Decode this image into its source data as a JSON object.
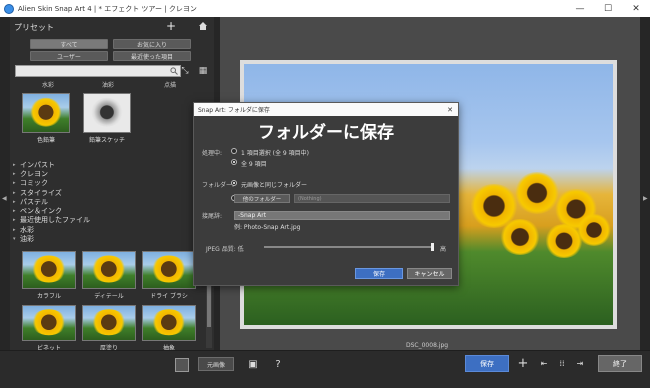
{
  "window": {
    "title": "Alien Skin Snap Art 4 | * エフェクト ツアー | クレヨン",
    "controls": [
      "—",
      "☐",
      "✕"
    ]
  },
  "sidebar": {
    "preset_title": "プリセット",
    "filters": {
      "all": "すべて",
      "favorites": "お気に入り",
      "user": "ユーザー",
      "recent": "最近使った項目"
    },
    "categories": {
      "watercolor": "水彩",
      "pencil": "油彩",
      "pointillism": "点描"
    },
    "top_thumbs": [
      "色鉛筆",
      "鉛筆スケッチ"
    ],
    "tree": [
      {
        "caret": "▸",
        "label": "インパスト"
      },
      {
        "caret": "▸",
        "label": "クレヨン"
      },
      {
        "caret": "▸",
        "label": "コミック"
      },
      {
        "caret": "▸",
        "label": "スタイライズ"
      },
      {
        "caret": "▸",
        "label": "パステル"
      },
      {
        "caret": "▸",
        "label": "ペン＆インク"
      },
      {
        "caret": "▸",
        "label": "最近使用したファイル"
      },
      {
        "caret": "▸",
        "label": "水彩"
      },
      {
        "caret": "▾",
        "label": "油彩"
      }
    ],
    "grid_thumbs": [
      "カラフル",
      "ディテール",
      "ドライ ブラシ",
      "ビネット",
      "厚塗り",
      "抽象"
    ]
  },
  "canvas": {
    "filename": "DSC_0008.jpg"
  },
  "bottombar": {
    "original_label": "元画像",
    "help_icon": "?",
    "save_label": "保存",
    "end_label": "終了"
  },
  "dialog": {
    "title": "Snap Art: フォルダに保存",
    "close": "✕",
    "heading": "フォルダーに保存",
    "process_label": "処理中:",
    "process_selected": "1 項目選択 (全 9 項目中)",
    "process_all": "全 9 項目",
    "folder_label": "フォルダー:",
    "same_folder": "元画像と同じフォルダー",
    "other_folder_btn": "他のフォルダー",
    "folder_placeholder": "(Nothing)",
    "suffix_label": "接尾辞:",
    "suffix_value": "-Snap Art",
    "example": "例: Photo-Snap Art.jpg",
    "jpeg_label": "JPEG 品質: 低",
    "jpeg_high": "高",
    "jpeg_quality": 0.98,
    "save_btn": "保存",
    "cancel_btn": "キャンセル"
  }
}
